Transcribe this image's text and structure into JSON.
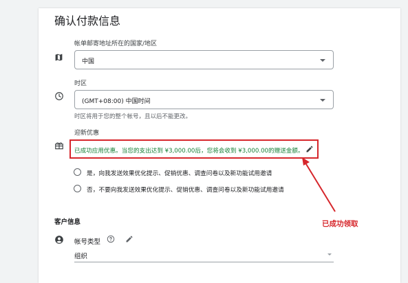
{
  "page": {
    "title": "确认付款信息"
  },
  "billing_country": {
    "label": "帐单邮寄地址所在的国家/地区",
    "value": "中国",
    "icon": "map-icon"
  },
  "timezone": {
    "label": "时区",
    "value": "(GMT+08:00) 中国时间",
    "helper": "时区将用于您的整个帐号，且以后不能更改。",
    "icon": "clock-icon"
  },
  "promo": {
    "label": "迎新优惠",
    "message": "已成功应用优惠。当您的支出达到 ¥3,000.00后，您将会收到 ¥3,000.00的赠送金额。",
    "icon": "gift-icon",
    "highlight_color": "#d6262b",
    "text_color": "#188038"
  },
  "email_prefs": {
    "options": [
      "是，向我发送效果优化提示、促销优惠、调查问卷以及新功能试用邀请",
      "否，不要向我发送效果优化提示、促销优惠、调查问卷以及新功能试用邀请"
    ]
  },
  "annotation": {
    "text": "已成功领取"
  },
  "customer_info": {
    "section_title": "客户信息",
    "account_type_label": "帐号类型",
    "account_type_value": "组织",
    "icon": "account-circle-icon"
  }
}
